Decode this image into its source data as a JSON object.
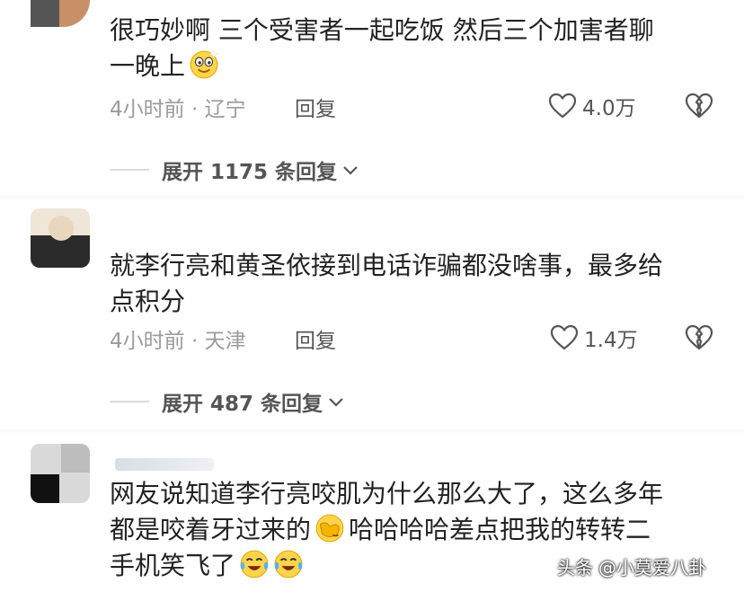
{
  "comments": [
    {
      "text_line1": "很巧妙啊 三个受害者一起吃饭 然后三个加害者聊",
      "text_line2": "一晚上",
      "emoji": "grinning-squint-emoji",
      "time": "4小时前",
      "location": "辽宁",
      "reply_label": "回复",
      "likes": "4.0万",
      "expand_label": "展开 1175 条回复"
    },
    {
      "text_line1": "就李行亮和黄圣依接到电话诈骗都没啥事，最多给",
      "text_line2": "点积分",
      "time": "4小时前",
      "location": "天津",
      "reply_label": "回复",
      "likes": "1.4万",
      "expand_label": "展开 487 条回复"
    },
    {
      "text_line1": "网友说知道李行亮咬肌为什么那么大了，这么多年",
      "text_line2": "都是咬着牙过来的",
      "text_line2b": "哈哈哈哈差点把我的转转二",
      "text_line3": "手机笑飞了",
      "emojis": [
        "facepalm-emoji",
        "tears-of-joy-emoji",
        "tears-of-joy-emoji"
      ]
    }
  ],
  "watermark": {
    "platform": "头条",
    "account": "@小莫爱八卦"
  },
  "colors": {
    "meta_gray": "#9b9b9b",
    "text_dark": "#222222",
    "divider": "#f6f6f6"
  }
}
